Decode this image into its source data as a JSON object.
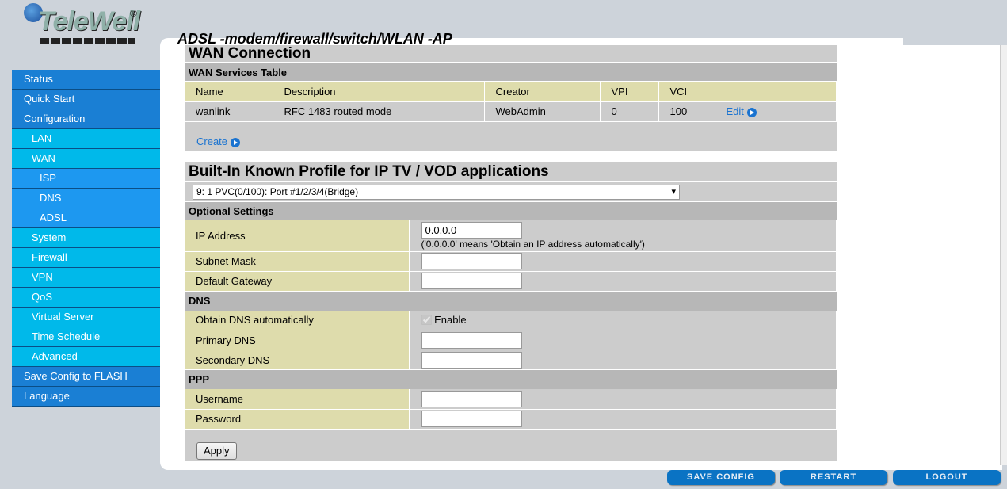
{
  "brand": {
    "logo": "TeleWell",
    "subtitle": "ADSL -modem/firewall/switch/WLAN -AP"
  },
  "sidebar": [
    {
      "label": "Status",
      "level": 1
    },
    {
      "label": "Quick Start",
      "level": 1
    },
    {
      "label": "Configuration",
      "level": 1
    },
    {
      "label": "LAN",
      "level": 2
    },
    {
      "label": "WAN",
      "level": 2
    },
    {
      "label": "ISP",
      "level": 3
    },
    {
      "label": "DNS",
      "level": 3
    },
    {
      "label": "ADSL",
      "level": 3
    },
    {
      "label": "System",
      "level": 2
    },
    {
      "label": "Firewall",
      "level": 2
    },
    {
      "label": "VPN",
      "level": 2
    },
    {
      "label": "QoS",
      "level": 2
    },
    {
      "label": "Virtual Server",
      "level": 2
    },
    {
      "label": "Time Schedule",
      "level": 2
    },
    {
      "label": "Advanced",
      "level": 2
    },
    {
      "label": "Save Config to FLASH",
      "level": 1
    },
    {
      "label": "Language",
      "level": 1
    }
  ],
  "wan": {
    "title": "WAN Connection",
    "table_title": "WAN Services Table",
    "columns": [
      "Name",
      "Description",
      "Creator",
      "VPI",
      "VCI"
    ],
    "row": {
      "name": "wanlink",
      "description": "RFC 1483 routed mode",
      "creator": "WebAdmin",
      "vpi": "0",
      "vci": "100",
      "edit": "Edit"
    },
    "create": "Create"
  },
  "profile": {
    "title": "Built-In Known Profile for IP TV / VOD applications",
    "selected": "9: 1 PVC(0/100): Port #1/2/3/4(Bridge)"
  },
  "optional": {
    "title": "Optional Settings",
    "ip_label": "IP Address",
    "ip_value": "0.0.0.0",
    "ip_hint": "('0.0.0.0' means 'Obtain an IP address automatically')",
    "subnet_label": "Subnet Mask",
    "gateway_label": "Default Gateway"
  },
  "dns": {
    "title": "DNS",
    "obtain_label": "Obtain DNS automatically",
    "enable_label": "Enable",
    "enabled": true,
    "primary_label": "Primary DNS",
    "secondary_label": "Secondary DNS"
  },
  "ppp": {
    "title": "PPP",
    "username_label": "Username",
    "password_label": "Password"
  },
  "apply": "Apply",
  "footer": {
    "save": "SAVE CONFIG",
    "restart": "RESTART",
    "logout": "LOGOUT"
  }
}
